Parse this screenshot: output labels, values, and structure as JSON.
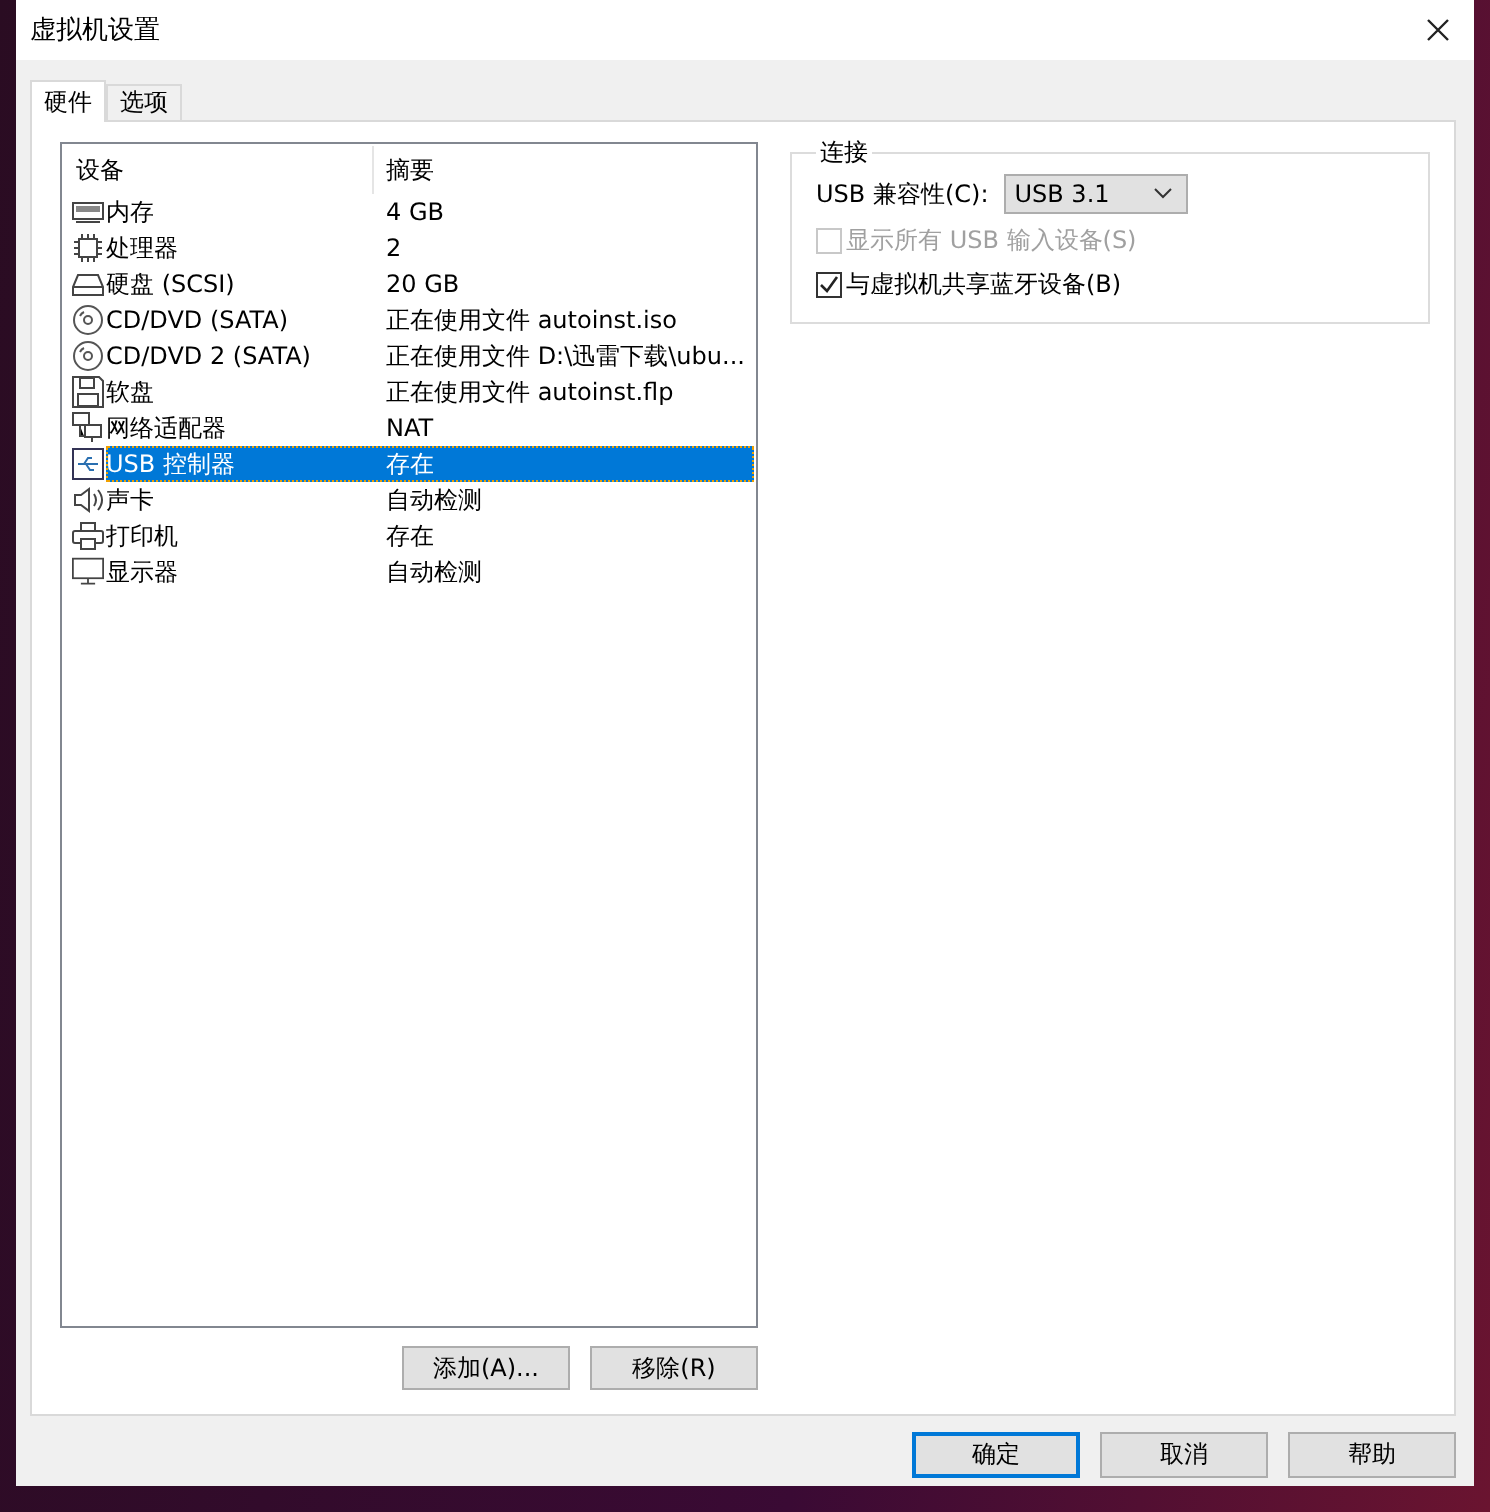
{
  "window": {
    "title": "虚拟机设置"
  },
  "tabs": [
    {
      "label": "硬件",
      "selected": true
    },
    {
      "label": "选项",
      "selected": false
    }
  ],
  "device_list": {
    "columns": [
      "设备",
      "摘要"
    ],
    "rows": [
      {
        "kind": "memory",
        "device": "内存",
        "summary": "4 GB",
        "selected": false
      },
      {
        "kind": "processor",
        "device": "处理器",
        "summary": "2",
        "selected": false
      },
      {
        "kind": "disk",
        "device": "硬盘 (SCSI)",
        "summary": "20 GB",
        "selected": false
      },
      {
        "kind": "cd",
        "device": "CD/DVD (SATA)",
        "summary": "正在使用文件 autoinst.iso",
        "selected": false
      },
      {
        "kind": "cd",
        "device": "CD/DVD 2 (SATA)",
        "summary": "正在使用文件 D:\\迅雷下载\\ubu...",
        "selected": false
      },
      {
        "kind": "floppy",
        "device": "软盘",
        "summary": "正在使用文件 autoinst.flp",
        "selected": false
      },
      {
        "kind": "network",
        "device": "网络适配器",
        "summary": "NAT",
        "selected": false
      },
      {
        "kind": "usb",
        "device": "USB 控制器",
        "summary": "存在",
        "selected": true
      },
      {
        "kind": "sound",
        "device": "声卡",
        "summary": "自动检测",
        "selected": false
      },
      {
        "kind": "printer",
        "device": "打印机",
        "summary": "存在",
        "selected": false
      },
      {
        "kind": "display",
        "device": "显示器",
        "summary": "自动检测",
        "selected": false
      }
    ]
  },
  "list_buttons": [
    "添加(A)...",
    "移除(R)"
  ],
  "connection": {
    "title": "连接",
    "compat_label": "USB 兼容性(C):",
    "compat_value": "USB 3.1",
    "options": [
      {
        "label": "显示所有 USB 输入设备(S)",
        "checked": false,
        "disabled": true
      },
      {
        "label": "与虚拟机共享蓝牙设备(B)",
        "checked": true,
        "disabled": false
      }
    ]
  },
  "dialog_buttons": [
    {
      "label": "确定",
      "default": true
    },
    {
      "label": "取消",
      "default": false
    },
    {
      "label": "帮助",
      "default": false
    }
  ]
}
